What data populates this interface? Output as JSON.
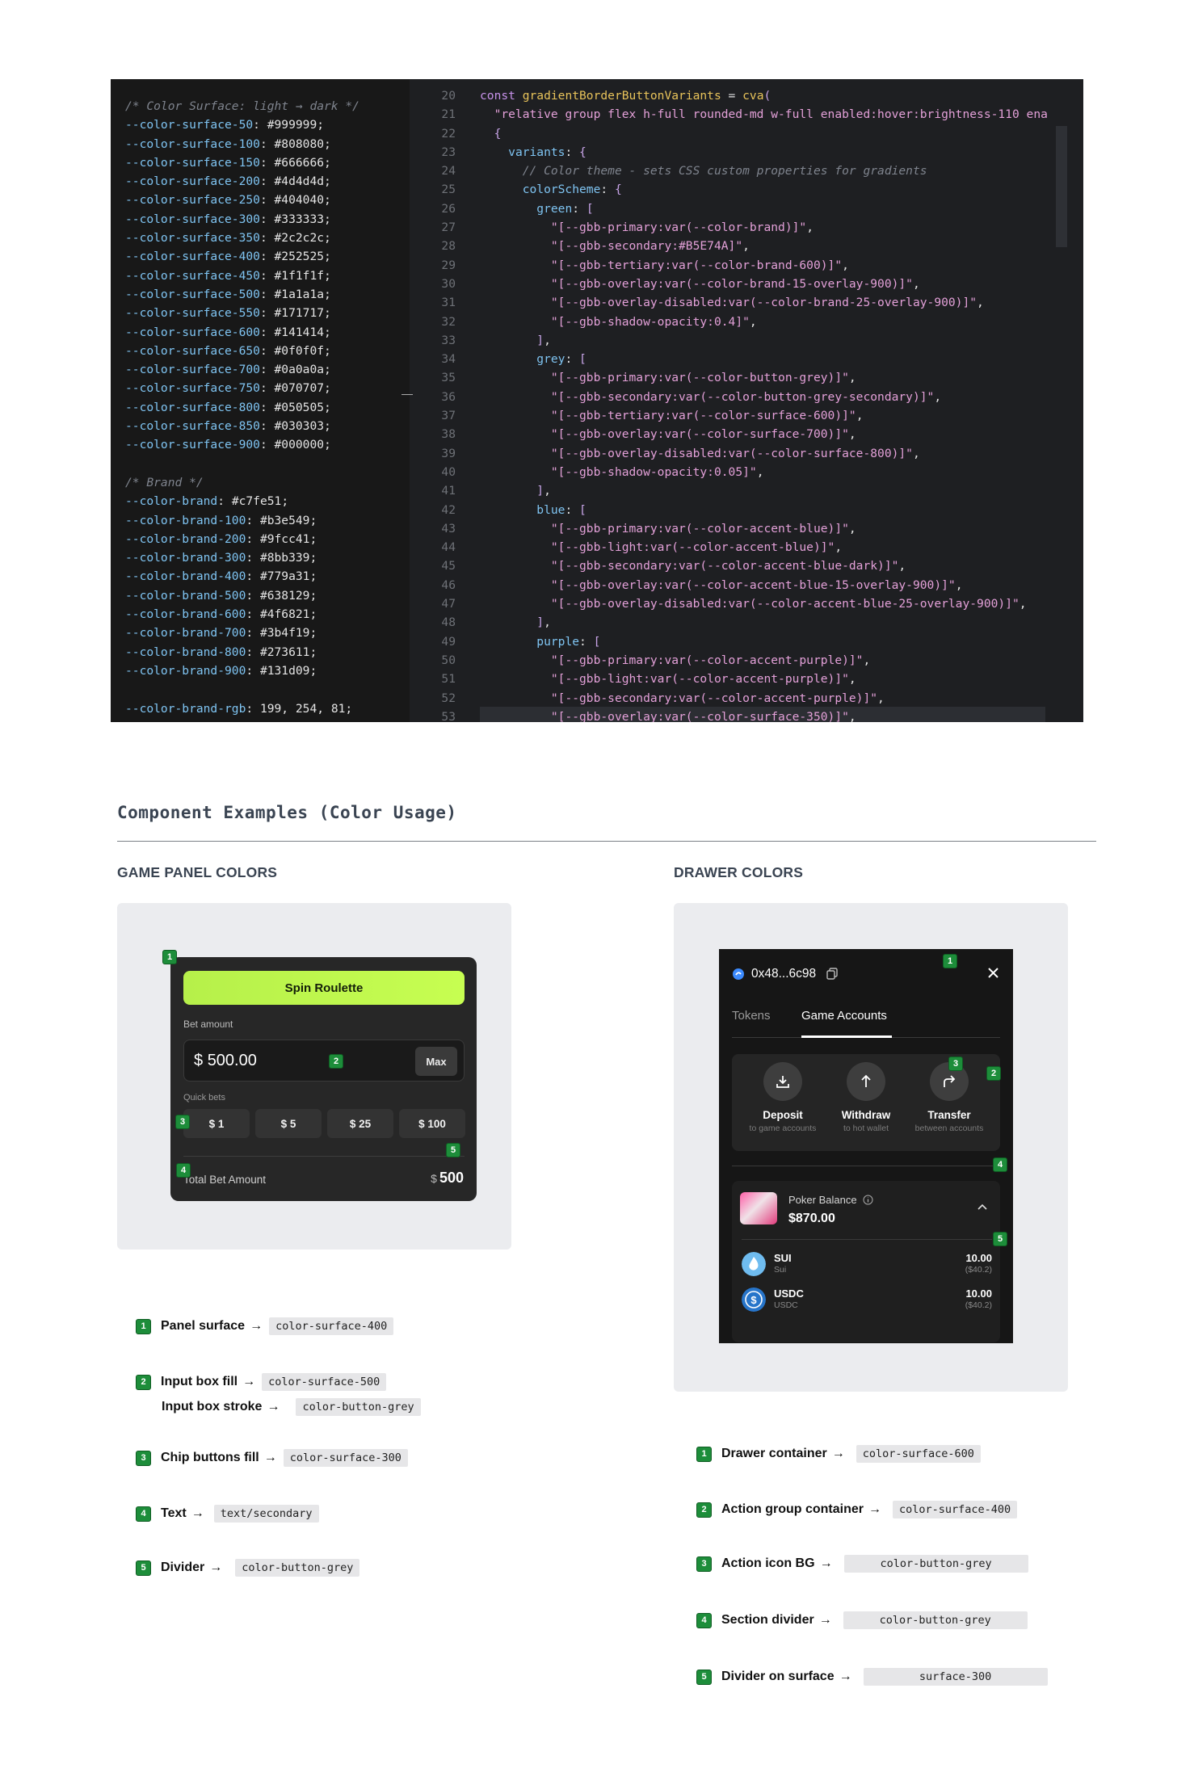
{
  "code_left": [
    {
      "t": "cm",
      "s": "/* Color Surface: light → dark */"
    },
    {
      "k": "--color-surface-50",
      "v": "#999999;"
    },
    {
      "k": "--color-surface-100",
      "v": "#808080;"
    },
    {
      "k": "--color-surface-150",
      "v": "#666666;"
    },
    {
      "k": "--color-surface-200",
      "v": "#4d4d4d;"
    },
    {
      "k": "--color-surface-250",
      "v": "#404040;"
    },
    {
      "k": "--color-surface-300",
      "v": "#333333;"
    },
    {
      "k": "--color-surface-350",
      "v": "#2c2c2c;"
    },
    {
      "k": "--color-surface-400",
      "v": "#252525;"
    },
    {
      "k": "--color-surface-450",
      "v": "#1f1f1f;"
    },
    {
      "k": "--color-surface-500",
      "v": "#1a1a1a;"
    },
    {
      "k": "--color-surface-550",
      "v": "#171717;"
    },
    {
      "k": "--color-surface-600",
      "v": "#141414;"
    },
    {
      "k": "--color-surface-650",
      "v": "#0f0f0f;"
    },
    {
      "k": "--color-surface-700",
      "v": "#0a0a0a;"
    },
    {
      "k": "--color-surface-750",
      "v": "#070707;"
    },
    {
      "k": "--color-surface-800",
      "v": "#050505;"
    },
    {
      "k": "--color-surface-850",
      "v": "#030303;"
    },
    {
      "k": "--color-surface-900",
      "v": "#000000;"
    },
    {
      "t": "blank",
      "s": ""
    },
    {
      "t": "cm",
      "s": "/* Brand */"
    },
    {
      "k": "--color-brand",
      "v": "#c7fe51;"
    },
    {
      "k": "--color-brand-100",
      "v": "#b3e549;"
    },
    {
      "k": "--color-brand-200",
      "v": "#9fcc41;"
    },
    {
      "k": "--color-brand-300",
      "v": "#8bb339;"
    },
    {
      "k": "--color-brand-400",
      "v": "#779a31;"
    },
    {
      "k": "--color-brand-500",
      "v": "#638129;"
    },
    {
      "k": "--color-brand-600",
      "v": "#4f6821;"
    },
    {
      "k": "--color-brand-700",
      "v": "#3b4f19;"
    },
    {
      "k": "--color-brand-800",
      "v": "#273611;"
    },
    {
      "k": "--color-brand-900",
      "v": "#131d09;"
    },
    {
      "t": "blank",
      "s": ""
    },
    {
      "k": "--color-brand-rgb",
      "v": "199, 254, 81;"
    }
  ],
  "code_right": [
    {
      "n": "20",
      "html": "<span class='pur'>const</span> <span class='yel'>gradientBorderButtonVariants</span> <span class='val'>=</span> <span class='yel'>cva</span><span class='br'>(</span>"
    },
    {
      "n": "21",
      "html": "  <span class='str'>\"relative group flex h-full rounded-md w-full enabled:hover:brightness-110 ena</span>"
    },
    {
      "n": "22",
      "html": "  <span class='br'>{</span>"
    },
    {
      "n": "23",
      "html": "    <span class='key'>variants</span><span class='val'>:</span> <span class='br'>{</span>"
    },
    {
      "n": "24",
      "html": "      <span class='cm'>// Color theme - sets CSS custom properties for gradients</span>"
    },
    {
      "n": "25",
      "html": "      <span class='key'>colorScheme</span><span class='val'>:</span> <span class='br'>{</span>"
    },
    {
      "n": "26",
      "html": "        <span class='key'>green</span><span class='val'>:</span> <span class='br'>[</span>"
    },
    {
      "n": "27",
      "html": "          <span class='str'>\"[--gbb-primary:var(--color-brand)]\"</span><span class='val'>,</span>"
    },
    {
      "n": "28",
      "html": "          <span class='str'>\"[--gbb-secondary:#B5E74A]\"</span><span class='val'>,</span>"
    },
    {
      "n": "29",
      "html": "          <span class='str'>\"[--gbb-tertiary:var(--color-brand-600)]\"</span><span class='val'>,</span>"
    },
    {
      "n": "30",
      "html": "          <span class='str'>\"[--gbb-overlay:var(--color-brand-15-overlay-900)]\"</span><span class='val'>,</span>"
    },
    {
      "n": "31",
      "html": "          <span class='str'>\"[--gbb-overlay-disabled:var(--color-brand-25-overlay-900)]\"</span><span class='val'>,</span>"
    },
    {
      "n": "32",
      "html": "          <span class='str'>\"[--gbb-shadow-opacity:0.4]\"</span><span class='val'>,</span>"
    },
    {
      "n": "33",
      "html": "        <span class='br'>]</span><span class='val'>,</span>"
    },
    {
      "n": "34",
      "html": "        <span class='key'>grey</span><span class='val'>:</span> <span class='br'>[</span>"
    },
    {
      "n": "35",
      "html": "          <span class='str'>\"[--gbb-primary:var(--color-button-grey)]\"</span><span class='val'>,</span>"
    },
    {
      "n": "36",
      "html": "          <span class='str'>\"[--gbb-secondary:var(--color-button-grey-secondary)]\"</span><span class='val'>,</span>"
    },
    {
      "n": "37",
      "html": "          <span class='str'>\"[--gbb-tertiary:var(--color-surface-600)]\"</span><span class='val'>,</span>"
    },
    {
      "n": "38",
      "html": "          <span class='str'>\"[--gbb-overlay:var(--color-surface-700)]\"</span><span class='val'>,</span>"
    },
    {
      "n": "39",
      "html": "          <span class='str'>\"[--gbb-overlay-disabled:var(--color-surface-800)]\"</span><span class='val'>,</span>"
    },
    {
      "n": "40",
      "html": "          <span class='str'>\"[--gbb-shadow-opacity:0.05]\"</span><span class='val'>,</span>"
    },
    {
      "n": "41",
      "html": "        <span class='br'>]</span><span class='val'>,</span>"
    },
    {
      "n": "42",
      "html": "        <span class='key'>blue</span><span class='val'>:</span> <span class='br'>[</span>"
    },
    {
      "n": "43",
      "html": "          <span class='str'>\"[--gbb-primary:var(--color-accent-blue)]\"</span><span class='val'>,</span>"
    },
    {
      "n": "44",
      "html": "          <span class='str'>\"[--gbb-light:var(--color-accent-blue)]\"</span><span class='val'>,</span>"
    },
    {
      "n": "45",
      "html": "          <span class='str'>\"[--gbb-secondary:var(--color-accent-blue-dark)]\"</span><span class='val'>,</span>"
    },
    {
      "n": "46",
      "html": "          <span class='str'>\"[--gbb-overlay:var(--color-accent-blue-15-overlay-900)]\"</span><span class='val'>,</span>"
    },
    {
      "n": "47",
      "html": "          <span class='str'>\"[--gbb-overlay-disabled:var(--color-accent-blue-25-overlay-900)]\"</span><span class='val'>,</span>"
    },
    {
      "n": "48",
      "html": "        <span class='br'>]</span><span class='val'>,</span>"
    },
    {
      "n": "49",
      "html": "        <span class='key'>purple</span><span class='val'>:</span> <span class='br'>[</span>"
    },
    {
      "n": "50",
      "html": "          <span class='str'>\"[--gbb-primary:var(--color-accent-purple)]\"</span><span class='val'>,</span>"
    },
    {
      "n": "51",
      "html": "          <span class='str'>\"[--gbb-light:var(--color-accent-purple)]\"</span><span class='val'>,</span>"
    },
    {
      "n": "52",
      "html": "          <span class='str'>\"[--gbb-secondary:var(--color-accent-purple)]\"</span><span class='val'>,</span>"
    },
    {
      "n": "53",
      "html": "          <span class='str'>\"[--gbb-overlay:var(--color-surface-350)]\"</span><span class='val'>,</span>"
    }
  ],
  "section_title": "Component Examples (Color Usage)",
  "game_panel": {
    "heading": "GAME PANEL COLORS",
    "spin_label": "Spin Roulette",
    "bet_label": "Bet amount",
    "bet_currency": "$",
    "bet_value": "500.00",
    "max_label": "Max",
    "quick_label": "Quick bets",
    "chips": [
      "$ 1",
      "$ 5",
      "$ 25",
      "$ 100"
    ],
    "total_label": "Total Bet Amount",
    "total_currency": "$",
    "total_value": "500",
    "legend": [
      {
        "n": "1",
        "label": "Panel surface",
        "tag": "color-surface-400"
      },
      {
        "n": "2",
        "label": "Input box fill",
        "tag": "color-surface-500",
        "label2": "Input box stroke",
        "tag2": "color-button-grey"
      },
      {
        "n": "3",
        "label": "Chip buttons fill",
        "tag": "color-surface-300"
      },
      {
        "n": "4",
        "label": "Text",
        "tag": "text/secondary"
      },
      {
        "n": "5",
        "label": "Divider",
        "tag": "color-button-grey"
      }
    ]
  },
  "drawer": {
    "heading": "DRAWER COLORS",
    "address": "0x48...6c98",
    "tab_tokens": "Tokens",
    "tab_game": "Game Accounts",
    "actions": [
      {
        "title": "Deposit",
        "sub": "to game accounts"
      },
      {
        "title": "Withdraw",
        "sub": "to hot wallet"
      },
      {
        "title": "Transfer",
        "sub": "between accounts"
      }
    ],
    "poker_label": "Poker Balance",
    "poker_value": "$870.00",
    "tokens": [
      {
        "name": "SUI",
        "sub": "Sui",
        "value": "10.00",
        "usd": "($40.2)"
      },
      {
        "name": "USDC",
        "sub": "USDC",
        "value": "10.00",
        "usd": "($40.2)"
      }
    ],
    "legend": [
      {
        "n": "1",
        "label": "Drawer container",
        "tag": "color-surface-600"
      },
      {
        "n": "2",
        "label": "Action group container",
        "tag": "color-surface-400"
      },
      {
        "n": "3",
        "label": "Action icon BG",
        "tag": "color-button-grey"
      },
      {
        "n": "4",
        "label": "Section divider",
        "tag": "color-button-grey"
      },
      {
        "n": "5",
        "label": "Divider on surface",
        "tag": "surface-300"
      }
    ]
  },
  "badges": {
    "b1": "1",
    "b2": "2",
    "b3": "3",
    "b4": "4",
    "b5": "5"
  },
  "arrow": "→"
}
